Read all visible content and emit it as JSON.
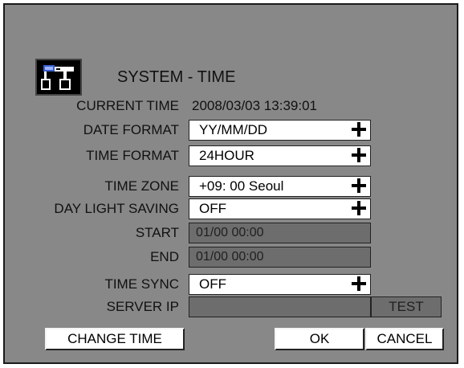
{
  "title": "SYSTEM - TIME",
  "icon": "tools-icon",
  "current_time": {
    "label": "CURRENT TIME",
    "value": "2008/03/03 13:39:01"
  },
  "date_format": {
    "label": "DATE FORMAT",
    "value": "YY/MM/DD"
  },
  "time_format": {
    "label": "TIME FORMAT",
    "value": "24HOUR"
  },
  "time_zone": {
    "label": "TIME ZONE",
    "value": "+09: 00 Seoul"
  },
  "day_light_saving": {
    "label": "DAY LIGHT SAVING",
    "value": "OFF"
  },
  "start": {
    "label": "START",
    "value": "01/00 00:00"
  },
  "end": {
    "label": "END",
    "value": "01/00 00:00"
  },
  "time_sync": {
    "label": "TIME SYNC",
    "value": "OFF"
  },
  "server_ip": {
    "label": "SERVER IP",
    "value": ""
  },
  "buttons": {
    "test": "TEST",
    "change_time": "CHANGE TIME",
    "ok": "OK",
    "cancel": "CANCEL"
  },
  "colors": {
    "panel_bg": "#888888",
    "field_white": "#ffffff",
    "field_disabled": "#6d6d6d",
    "icon_blue": "#3a5fcd"
  }
}
